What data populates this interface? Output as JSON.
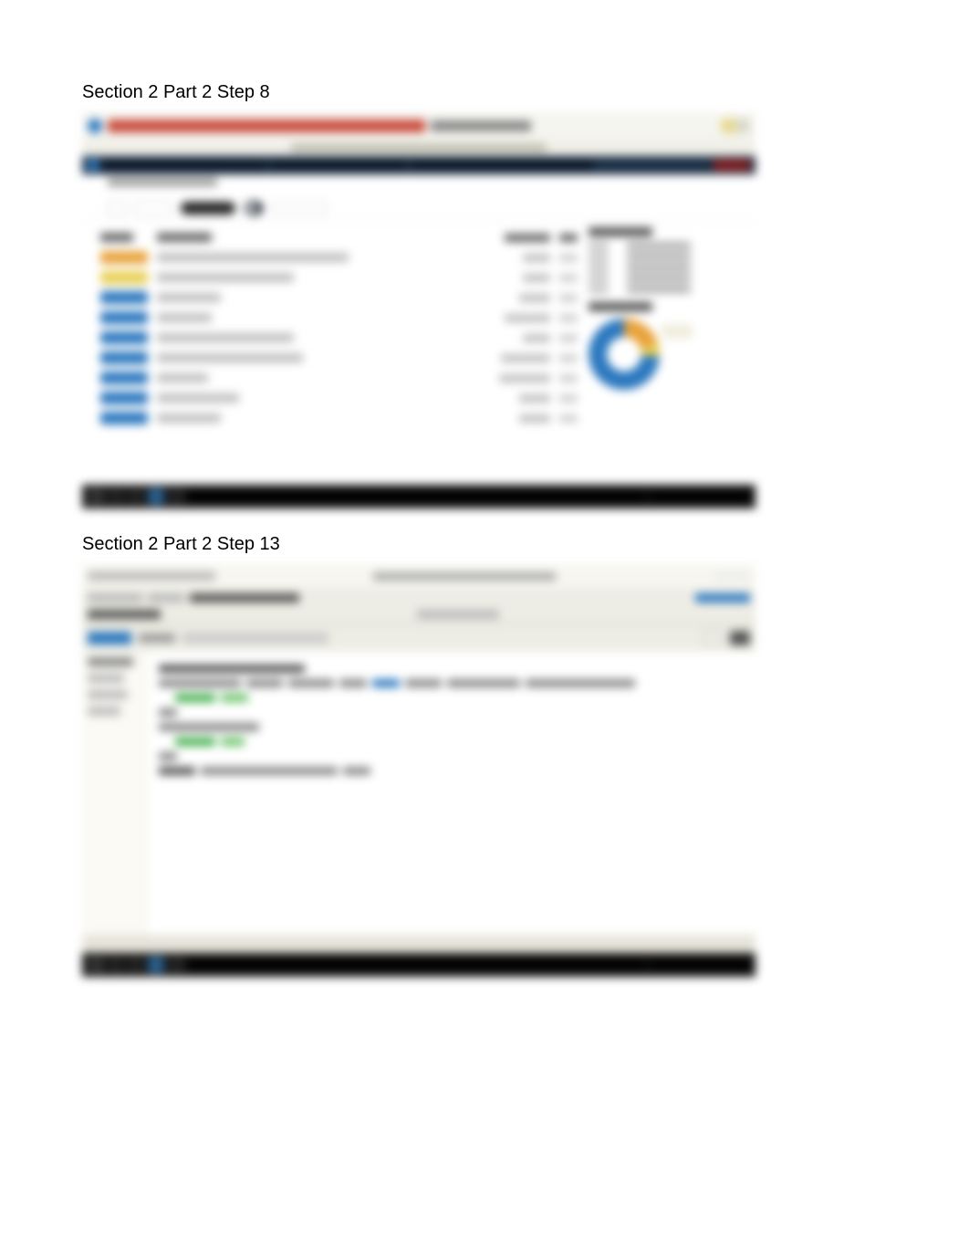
{
  "headings": {
    "step8": "Section 2 Part 2 Step 8",
    "step13": "Section 2 Part 2 Step 13"
  },
  "panel1": {
    "top": {
      "logo_label": "browser-logo",
      "url_bar": "obscured url",
      "url_suffix": "obscured url tail"
    },
    "navbar": {
      "items": [
        "seg1",
        "seg2",
        "seg3"
      ],
      "logout": "logout"
    },
    "crumb": "breadcrumb path",
    "filter": {
      "label": "Status",
      "option": "All"
    },
    "table": {
      "header": {
        "c1": "Level",
        "c2": "Name",
        "c3": "Category",
        "c4": "Count"
      },
      "rows": [
        {
          "badge": "orange",
          "name_w": 210,
          "c2_w": 30,
          "c3": 1
        },
        {
          "badge": "yellow",
          "name_w": 150,
          "c2_w": 30,
          "c3": 1
        },
        {
          "badge": "blue",
          "name_w": 70,
          "c2_w": 34,
          "c3": 1
        },
        {
          "badge": "blue",
          "name_w": 60,
          "c2_w": 50,
          "c3": 1
        },
        {
          "badge": "blue",
          "name_w": 150,
          "c2_w": 30,
          "c3": 1
        },
        {
          "badge": "blue",
          "name_w": 160,
          "c2_w": 54,
          "c3": 1
        },
        {
          "badge": "blue",
          "name_w": 56,
          "c2_w": 56,
          "c3": 1
        },
        {
          "badge": "blue",
          "name_w": 90,
          "c2_w": 34,
          "c3": 1
        },
        {
          "badge": "blue",
          "name_w": 70,
          "c2_w": 34,
          "c3": 1
        }
      ]
    },
    "sidebar": {
      "heading": "Summary",
      "kv": [
        {
          "k": "k1",
          "v": "v1"
        },
        {
          "k": "k2",
          "v": "v2"
        },
        {
          "k": "k3",
          "v": "v3"
        },
        {
          "k": "k4",
          "v": "v4"
        },
        {
          "k": "k5",
          "v": "v5"
        }
      ],
      "chart_heading": "Totals"
    }
  },
  "chart_data": {
    "type": "pie",
    "title": "Totals",
    "categories": [
      "Orange",
      "Yellow",
      "Blue"
    ],
    "values": [
      20,
      6,
      74
    ],
    "callout": "obscured"
  },
  "panel2": {
    "titlebar": {
      "menu": "File Edit View",
      "center": "obscured document title"
    },
    "ribbon": {
      "row1": [
        "item",
        "item",
        "item"
      ],
      "tabs": [
        "Tab1",
        "Tab2"
      ],
      "active_tab": "Tab1"
    },
    "left_panel": {
      "items": [
        "item1",
        "item2",
        "item3",
        "item4"
      ]
    },
    "code": {
      "lines": [
        {
          "tokens": [
            [
              "dgray",
              160
            ]
          ]
        },
        {
          "tokens": [
            [
              "gray",
              90
            ],
            [
              "gray",
              40
            ],
            [
              "gray",
              50
            ],
            [
              "gray",
              30
            ],
            [
              "blue",
              30
            ],
            [
              "gray",
              40
            ],
            [
              "gray",
              80
            ],
            [
              "gray",
              120
            ]
          ]
        },
        {
          "indent": 1,
          "tokens": [
            [
              "green",
              44
            ],
            [
              "lgreen",
              30
            ]
          ]
        },
        {
          "tokens": [
            [
              "gray",
              20
            ]
          ]
        },
        {
          "tokens": [
            [
              "gray",
              110
            ]
          ]
        },
        {
          "indent": 1,
          "tokens": [
            [
              "green",
              44
            ],
            [
              "lgreen",
              26
            ]
          ]
        },
        {
          "tokens": [
            [
              "gray",
              20
            ]
          ]
        },
        {
          "tokens": [
            [
              "dgray",
              40
            ],
            [
              "gray",
              150
            ],
            [
              "gray",
              30
            ]
          ]
        }
      ]
    }
  }
}
